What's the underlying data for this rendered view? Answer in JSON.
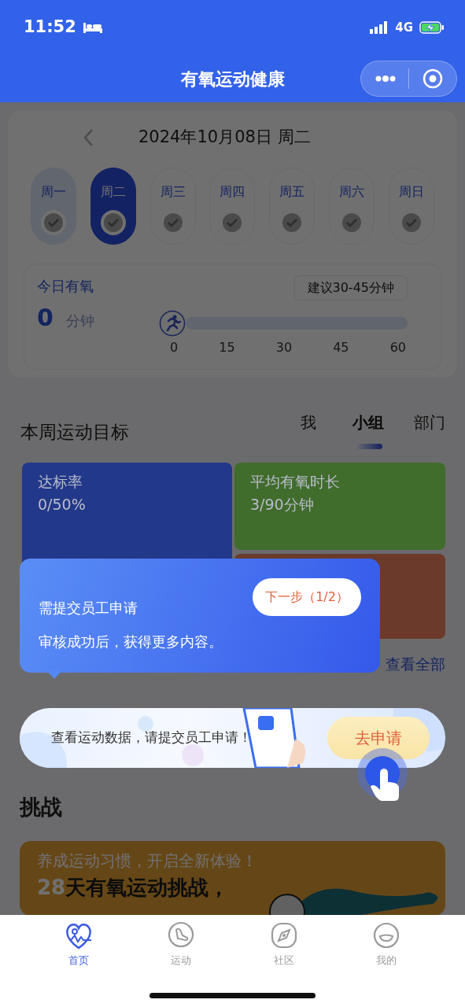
{
  "status_bar": {
    "time": "11:52",
    "network": "4G"
  },
  "header": {
    "title": "有氧运动健康"
  },
  "date_nav": {
    "date": "2024年10月08日 周二"
  },
  "week_days": [
    {
      "label": "周一",
      "selected": false,
      "past": true
    },
    {
      "label": "周二",
      "selected": true,
      "past": false
    },
    {
      "label": "周三",
      "selected": false,
      "past": false
    },
    {
      "label": "周四",
      "selected": false,
      "past": false
    },
    {
      "label": "周五",
      "selected": false,
      "past": false
    },
    {
      "label": "周六",
      "selected": false,
      "past": false
    },
    {
      "label": "周日",
      "selected": false,
      "past": false
    }
  ],
  "today_card": {
    "title": "今日有氧",
    "value": "0",
    "unit": "分钟",
    "suggestion": "建议30-45分钟",
    "level": 0,
    "ticks": [
      "0",
      "15",
      "30",
      "45",
      "60"
    ]
  },
  "weekly_goal": {
    "title": "本周运动目标",
    "tabs": [
      {
        "label": "我",
        "selected": false
      },
      {
        "label": "小组",
        "selected": true
      },
      {
        "label": "部门",
        "selected": false
      }
    ],
    "cards": [
      {
        "title": "达标率",
        "value": "0/50%",
        "color": "#22388a"
      },
      {
        "title": "平均有氧时长",
        "value": "3/90分钟",
        "color": "#406c2c"
      },
      {
        "color": "#6b3a2b"
      }
    ],
    "view_all": "查看全部"
  },
  "tooltip": {
    "title": "需提交员工申请",
    "text": "审核成功后，获得更多内容。",
    "next_button": "下一步（1/2）"
  },
  "apply_banner": {
    "text": "查看运动数据，请提交员工申请！",
    "button": "去申请"
  },
  "challenge": {
    "title": "挑战",
    "subtitle": "养成运动习惯，开启全新体验！",
    "headline_number": "28",
    "headline_text": "天有氧运动挑战，"
  },
  "tab_bar": [
    {
      "label": "首页",
      "kind": "home",
      "selected": true
    },
    {
      "label": "运动",
      "kind": "sport",
      "selected": false
    },
    {
      "label": "社区",
      "kind": "community",
      "selected": false
    },
    {
      "label": "我的",
      "kind": "me",
      "selected": false
    }
  ]
}
